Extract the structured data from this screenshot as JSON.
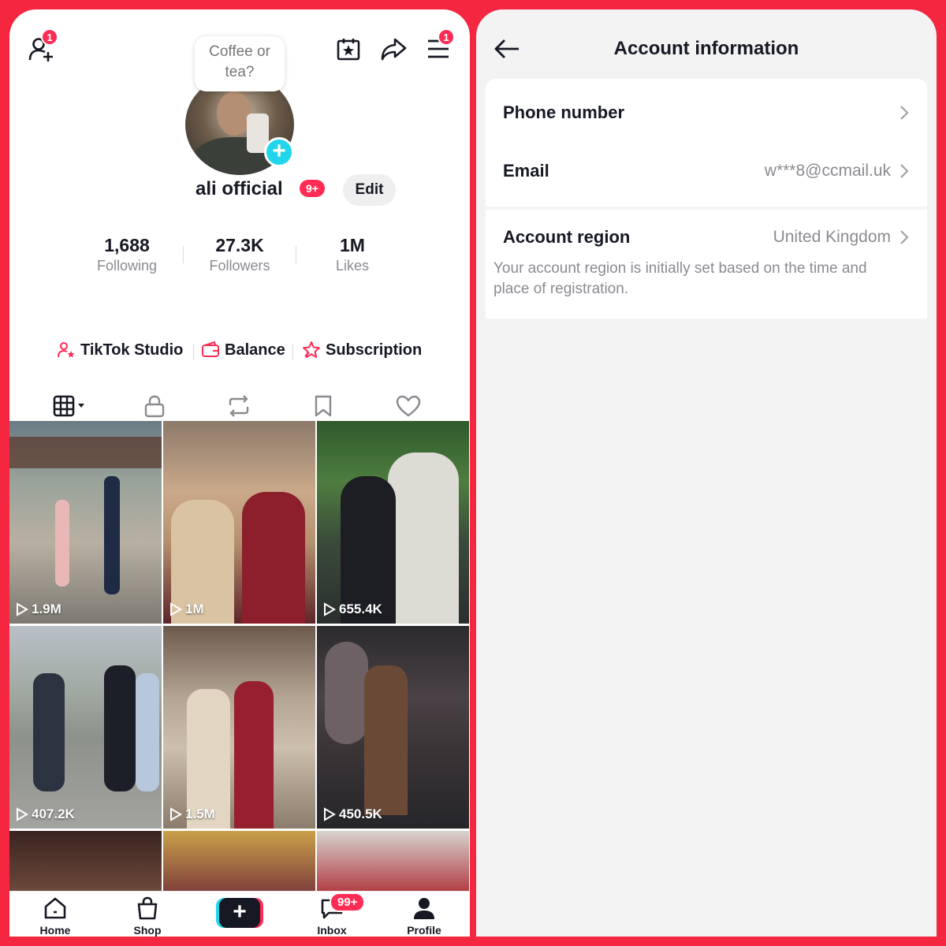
{
  "profile": {
    "note": "Coffee or tea?",
    "add_friend_badge": "1",
    "menu_badge": "1",
    "username": "ali official",
    "username_badge": "9+",
    "edit_label": "Edit",
    "stats": [
      {
        "value": "1,688",
        "label": "Following"
      },
      {
        "value": "27.3K",
        "label": "Followers"
      },
      {
        "value": "1M",
        "label": "Likes"
      }
    ],
    "shortcuts": [
      "TikTok Studio",
      "Balance",
      "Subscription"
    ],
    "videos": [
      {
        "views": "1.9M"
      },
      {
        "views": "1M"
      },
      {
        "views": "655.4K"
      },
      {
        "views": "407.2K"
      },
      {
        "views": "1.5M"
      },
      {
        "views": "450.5K"
      }
    ],
    "nav": {
      "home": "Home",
      "shop": "Shop",
      "inbox": "Inbox",
      "inbox_badge": "99+",
      "profile": "Profile"
    }
  },
  "account": {
    "title": "Account information",
    "phone_label": "Phone number",
    "email_label": "Email",
    "email_value": "w***8@ccmail.uk",
    "region_label": "Account region",
    "region_value": "United Kingdom",
    "region_desc": "Your account region is initially set based on the time and place of registration."
  },
  "colors": {
    "frame": "#f5263f",
    "accent": "#fe2c55",
    "cyan": "#20d5ec"
  }
}
